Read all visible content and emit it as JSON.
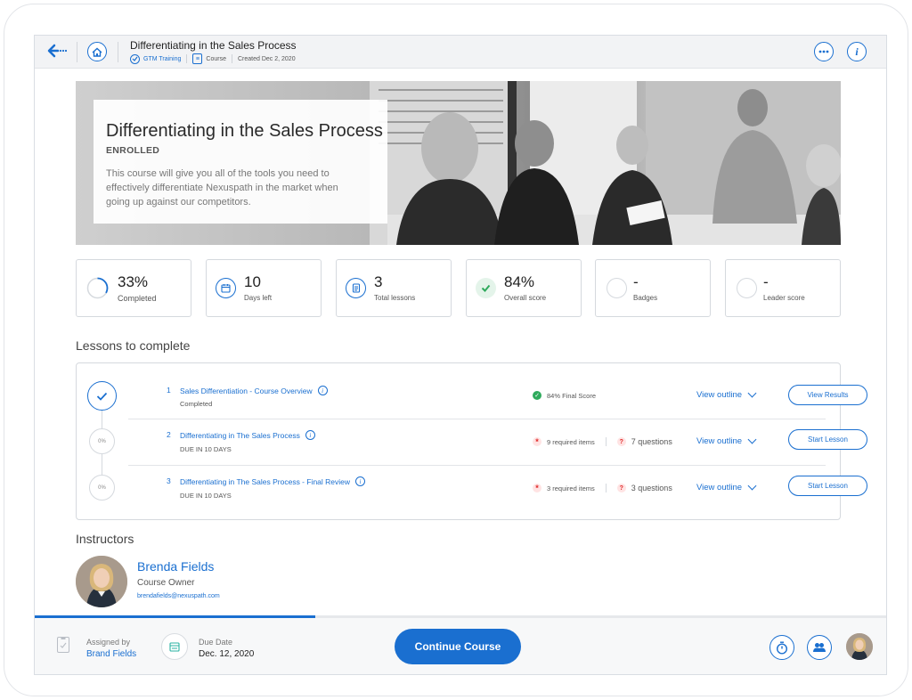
{
  "header": {
    "title": "Differentiating in the Sales Process",
    "tag": "GTM Training",
    "type": "Course",
    "created": "Created Dec 2, 2020"
  },
  "hero": {
    "title": "Differentiating in the Sales Process",
    "status": "ENROLLED",
    "description": "This course will give you all of the tools you need to effectively differentiate Nexuspath in the market when going up against our competitors."
  },
  "stats": [
    {
      "value": "33%",
      "label": "Completed",
      "progress": 0.33
    },
    {
      "value": "10",
      "label": "Days left"
    },
    {
      "value": "3",
      "label": "Total lessons"
    },
    {
      "value": "84%",
      "label": "Overall score"
    },
    {
      "value": "-",
      "label": "Badges"
    },
    {
      "value": "-",
      "label": "Leader score"
    }
  ],
  "lessons_section": {
    "title": "Lessons to complete",
    "items": [
      {
        "num": "1",
        "title": "Sales Differentiation - Course Overview",
        "status": "Completed",
        "progress": "",
        "score": "84% Final Score",
        "required": "",
        "questions": "",
        "outline": "View outline",
        "button": "View Results"
      },
      {
        "num": "2",
        "title": "Differentiating in The Sales Process",
        "status": "DUE IN 10 DAYS",
        "progress": "0%",
        "score": "",
        "required": "9 required items",
        "questions": "7 questions",
        "outline": "View outline",
        "button": "Start Lesson"
      },
      {
        "num": "3",
        "title": "Differentiating in The Sales Process - Final Review",
        "status": "DUE IN 10 DAYS",
        "progress": "0%",
        "score": "",
        "required": "3 required items",
        "questions": "3 questions",
        "outline": "View outline",
        "button": "Start Lesson"
      }
    ]
  },
  "instructors": {
    "title": "Instructors",
    "name": "Brenda Fields",
    "role": "Course Owner",
    "email": "brendafields@nexuspath.com"
  },
  "footer": {
    "assigned_label": "Assigned by",
    "assigned_value": "Brand Fields",
    "due_label": "Due Date",
    "due_value": "Dec. 12, 2020",
    "continue_label": "Continue Course",
    "course_progress": 0.33
  },
  "colors": {
    "accent": "#1a6fd0",
    "success": "#2eaa5c",
    "alert": "#e02828"
  },
  "icons": [
    "back-arrow-icon",
    "home-icon",
    "more-icon",
    "info-icon",
    "check-icon",
    "calendar-icon",
    "document-icon",
    "clipboard-icon",
    "timer-icon",
    "group-icon"
  ]
}
